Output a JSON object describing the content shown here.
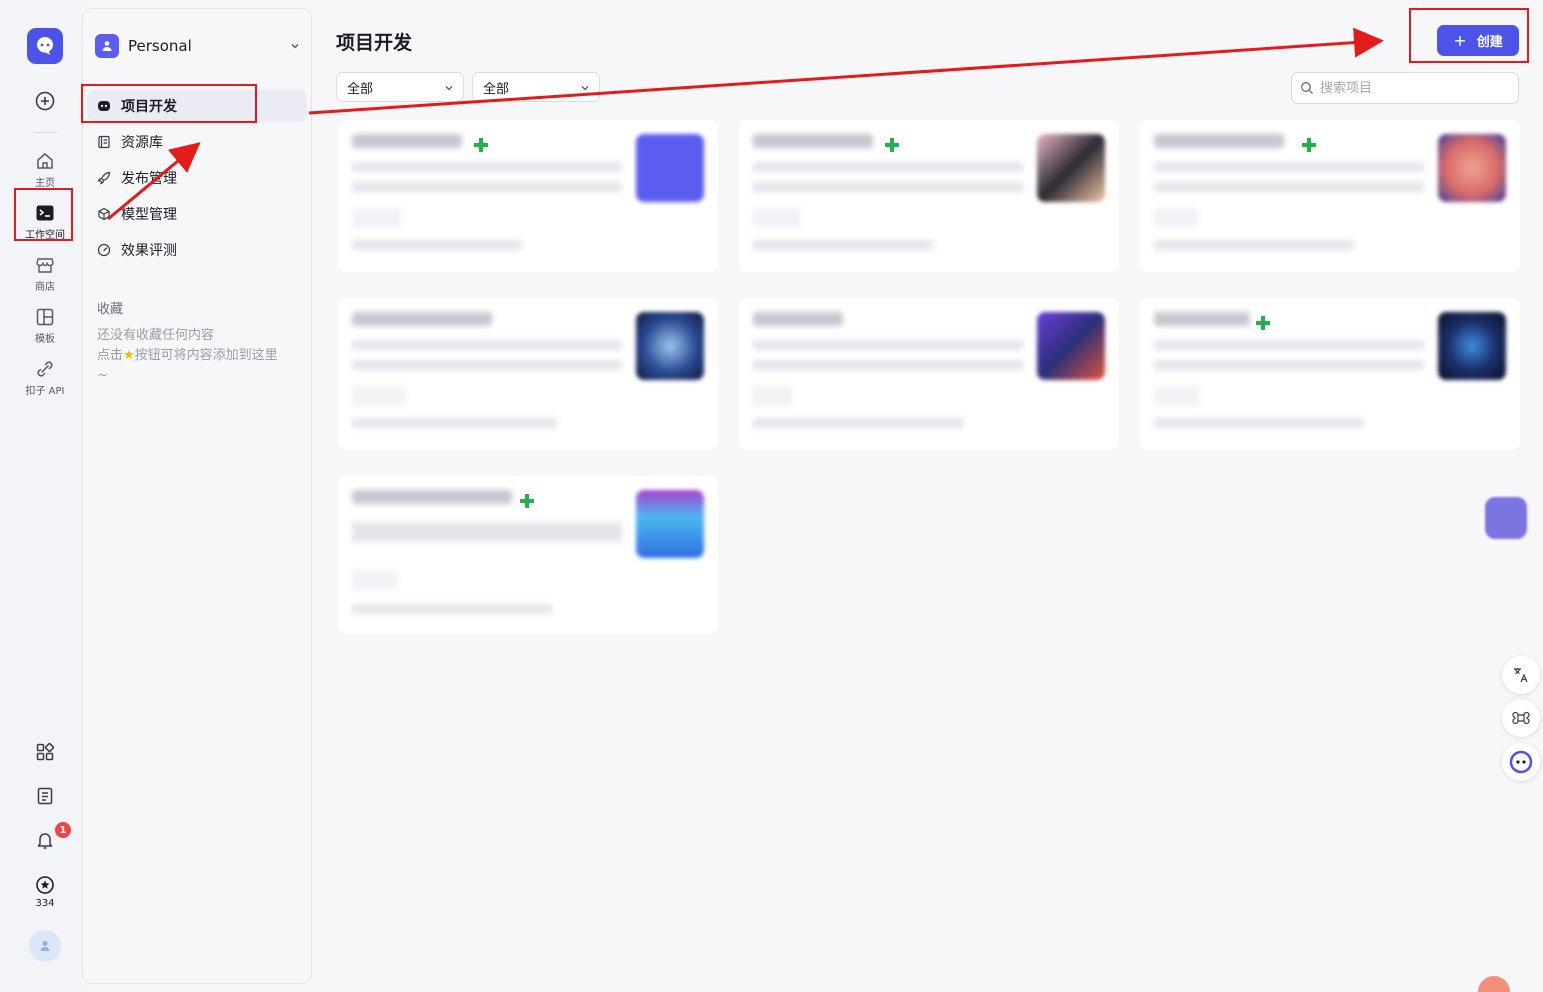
{
  "rail": {
    "items": [
      {
        "label": "主页",
        "icon": "home-icon"
      },
      {
        "label": "工作空间",
        "icon": "workspace-icon"
      },
      {
        "label": "商店",
        "icon": "store-icon"
      },
      {
        "label": "模板",
        "icon": "template-icon"
      },
      {
        "label": "扣子 API",
        "icon": "api-icon"
      }
    ],
    "notification_count": "1",
    "points": "334"
  },
  "panel": {
    "space_name": "Personal",
    "nav": [
      {
        "label": "项目开发",
        "icon": "robot-icon"
      },
      {
        "label": "资源库",
        "icon": "library-icon"
      },
      {
        "label": "发布管理",
        "icon": "rocket-icon"
      },
      {
        "label": "模型管理",
        "icon": "model-icon"
      },
      {
        "label": "效果评测",
        "icon": "gauge-icon"
      }
    ],
    "favorites_title": "收藏",
    "favorites_empty_line1": "还没有收藏任何内容",
    "favorites_empty_line2_a": "点击",
    "favorites_empty_line2_b": "按钮可将内容添加到这里",
    "favorites_empty_line3": "~"
  },
  "main": {
    "title": "项目开发",
    "create_label": "创建",
    "filter1": "全部",
    "filter2": "全部",
    "search_placeholder": "搜索项目"
  },
  "colors": {
    "accent": "#4d53e8",
    "annotation_red": "#e21b1b",
    "badge_green": "#22b14c"
  }
}
